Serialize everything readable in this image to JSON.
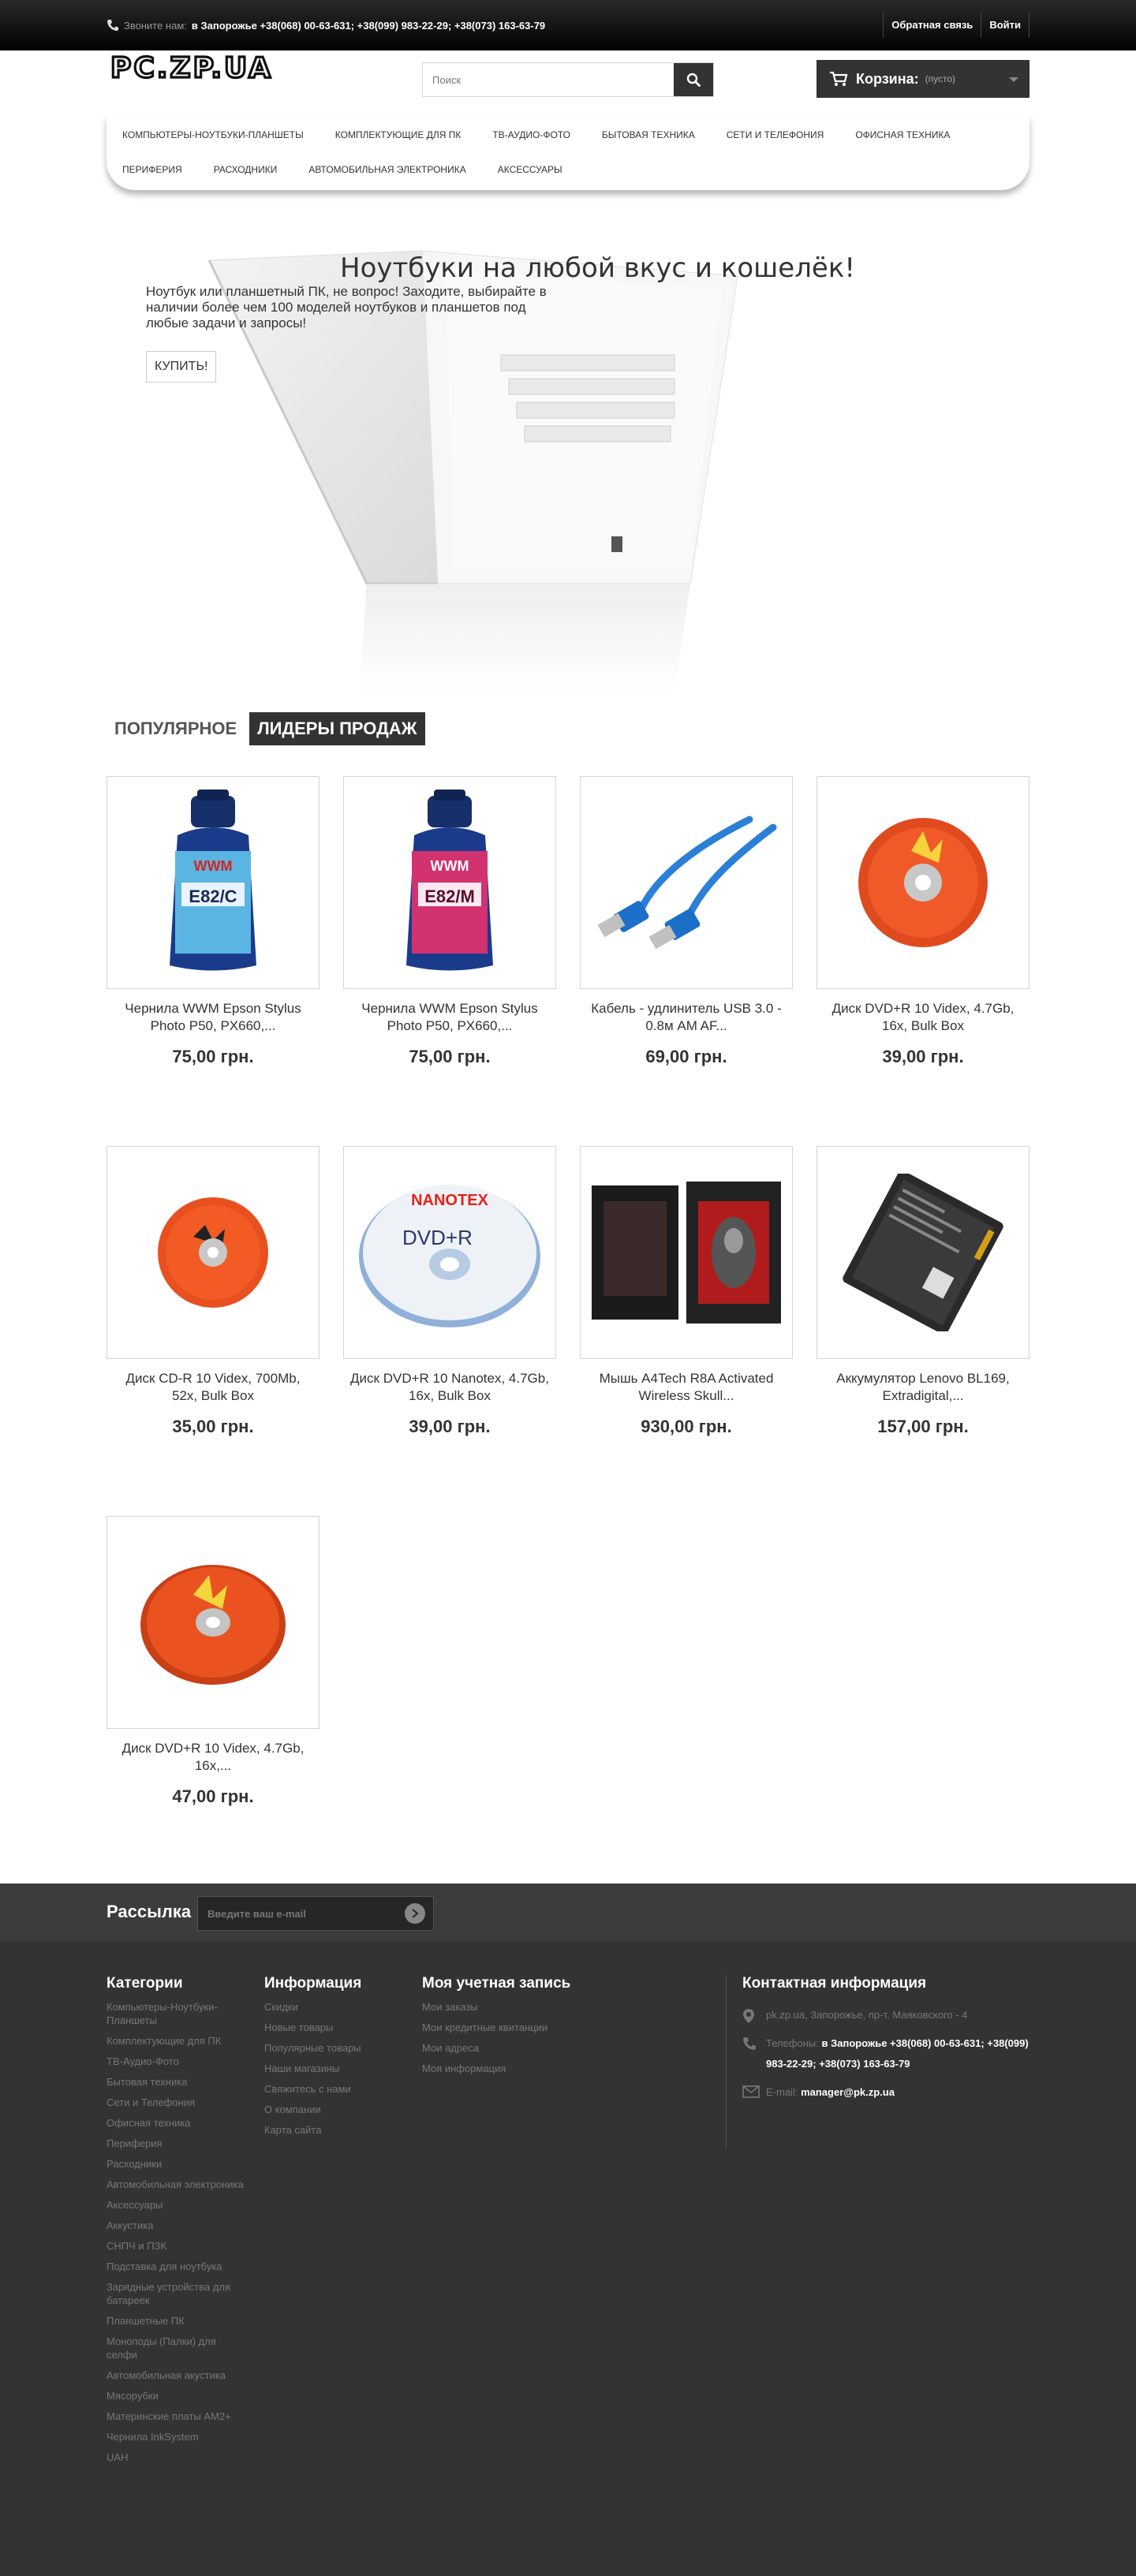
{
  "topbar": {
    "call_label": "Звоните нам:",
    "phones": "в Запорожье +38(068) 00-63-631; +38(099) 983-22-29; +38(073) 163-63-79",
    "links": [
      "Обратная связь",
      "Войти"
    ]
  },
  "header": {
    "logo_text": "PC.ZP.UA",
    "search_placeholder": "Поиск",
    "cart_label": "Корзина:",
    "cart_status": "(пусто)"
  },
  "menu": {
    "row1": [
      "Компьютеры-Ноутбуки-Планшеты",
      "Комплектующие для ПК",
      "ТВ-Аудио-Фото",
      "Бытовая техника",
      "Сети и телефония",
      "Офисная техника"
    ],
    "row2": [
      "Периферия",
      "Расходники",
      "Автомобильная электроника",
      "Аксессуары"
    ]
  },
  "hero": {
    "title": "Ноутбуки на любой вкус и кошелёк!",
    "text": "Ноутбук или планшетный ПК, не вопрос! Заходите, выбирайте в наличии более чем 100 моделей ноутбуков и планшетов под любые задачи и запросы!",
    "button": "КУПИТЬ!"
  },
  "tabs": [
    "Популярное",
    "Лидеры продаж"
  ],
  "products": [
    {
      "name": "Чернила WWM Epson Stylus Photo P50, PX660,...",
      "price": "75,00 грн."
    },
    {
      "name": "Чернила WWM Epson Stylus Photo P50, PX660,...",
      "price": "75,00 грн."
    },
    {
      "name": "Кабель - удлинитель USB 3.0 - 0.8м AM AF...",
      "price": "69,00 грн."
    },
    {
      "name": "Диск DVD+R 10 Videx, 4.7Gb, 16x, Bulk Box",
      "price": "39,00 грн."
    },
    {
      "name": "Диск CD-R 10 Videx, 700Mb, 52x, Bulk Box",
      "price": "35,00 грн."
    },
    {
      "name": "Диск DVD+R 10 Nanotex, 4.7Gb, 16x, Bulk Box",
      "price": "39,00 грн."
    },
    {
      "name": "Мышь A4Tech R8A Activated Wireless Skull...",
      "price": "930,00 грн."
    },
    {
      "name": "Аккумулятор Lenovo BL169, Extradigital,...",
      "price": "157,00 грн."
    },
    {
      "name": "Диск DVD+R 10 Videx, 4.7Gb, 16x,...",
      "price": "47,00 грн."
    }
  ],
  "ink_labels": {
    "cyan": "E82/C",
    "magenta": "E82/M",
    "brand": "WWM"
  },
  "nanotex_label": "NANOTEX",
  "dvd_label": "DVD+R",
  "newsletter": {
    "label": "Рассылка",
    "placeholder": "Введите ваш e-mail"
  },
  "footer": {
    "categories_title": "Категории",
    "categories": [
      "Компьютеры-Ноутбуки-Планшеты",
      "Комплектующие для ПК",
      "ТВ-Аудио-Фото",
      "Бытовая техника",
      "Сети и Телефония",
      "Офисная техника",
      "Периферия",
      "Расходники",
      "Автомобильная электроника",
      "Аксессуары",
      "Аккустика",
      "СНПЧ и ПЗК",
      "Подставка для ноутбука",
      "Зарядные устройства для батареек",
      "Планшетные ПК",
      "Моноподы (Палки) для селфи",
      "Автомобильная акустика",
      "Мясорубки",
      "Материнские платы AM2+",
      "Чернила InkSystem",
      "UAH"
    ],
    "info_title": "Информация",
    "info": [
      "Скидки",
      "Новые товары",
      "Популярные товары",
      "Наши магазины",
      "Свяжитесь с нами",
      "О компании",
      "Карта сайта"
    ],
    "account_title": "Моя учетная запись",
    "account": [
      "Мои заказы",
      "Мои кредитные квитанции",
      "Мои адреса",
      "Моя информация"
    ],
    "contact_title": "Контактная информация",
    "address": "pk.zp.ua, Запорожье, пр-т. Маяковского - 4",
    "phone_label": "Телефоны:",
    "phones": "в Запорожье +38(068) 00-63-631; +38(099) 983-22-29; +38(073) 163-63-79",
    "email_label": "E-mail:",
    "email": "manager@pk.zp.ua"
  }
}
